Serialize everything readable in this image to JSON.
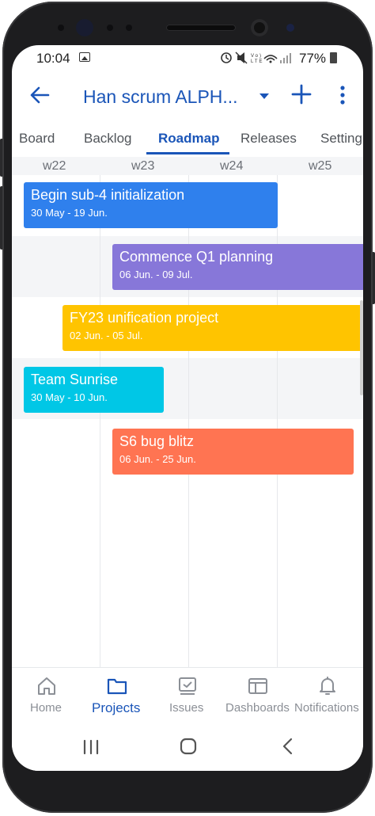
{
  "status": {
    "time": "10:04",
    "battery": "77%"
  },
  "appbar": {
    "title": "Han scrum ALPH..."
  },
  "tabs": [
    {
      "label": "Board"
    },
    {
      "label": "Backlog"
    },
    {
      "label": "Roadmap"
    },
    {
      "label": "Releases"
    },
    {
      "label": "Setting"
    }
  ],
  "weeks": [
    "w22",
    "w23",
    "w24",
    "w25"
  ],
  "roadmap": {
    "items": [
      {
        "title": "Begin sub-4 initialization",
        "dates": "30 May - 19 Jun.",
        "color": "#2f80ed"
      },
      {
        "title": "Commence Q1 planning",
        "dates": "06 Jun. - 09 Jul.",
        "color": "#8777d9"
      },
      {
        "title": "FY23 unification project",
        "dates": "02 Jun. - 05 Jul.",
        "color": "#ffc400"
      },
      {
        "title": "Team Sunrise",
        "dates": "30 May - 10 Jun.",
        "color": "#00c7e6"
      },
      {
        "title": "S6 bug blitz",
        "dates": "06 Jun. - 25 Jun.",
        "color": "#ff7452"
      }
    ]
  },
  "bottom_nav": [
    {
      "label": "Home",
      "icon": "home-icon"
    },
    {
      "label": "Projects",
      "icon": "folder-icon"
    },
    {
      "label": "Issues",
      "icon": "issues-icon"
    },
    {
      "label": "Dashboards",
      "icon": "dashboard-icon"
    },
    {
      "label": "Notifications",
      "icon": "bell-icon"
    }
  ],
  "colors": {
    "accent": "#1a55b8",
    "inactive": "#8b8f96"
  }
}
